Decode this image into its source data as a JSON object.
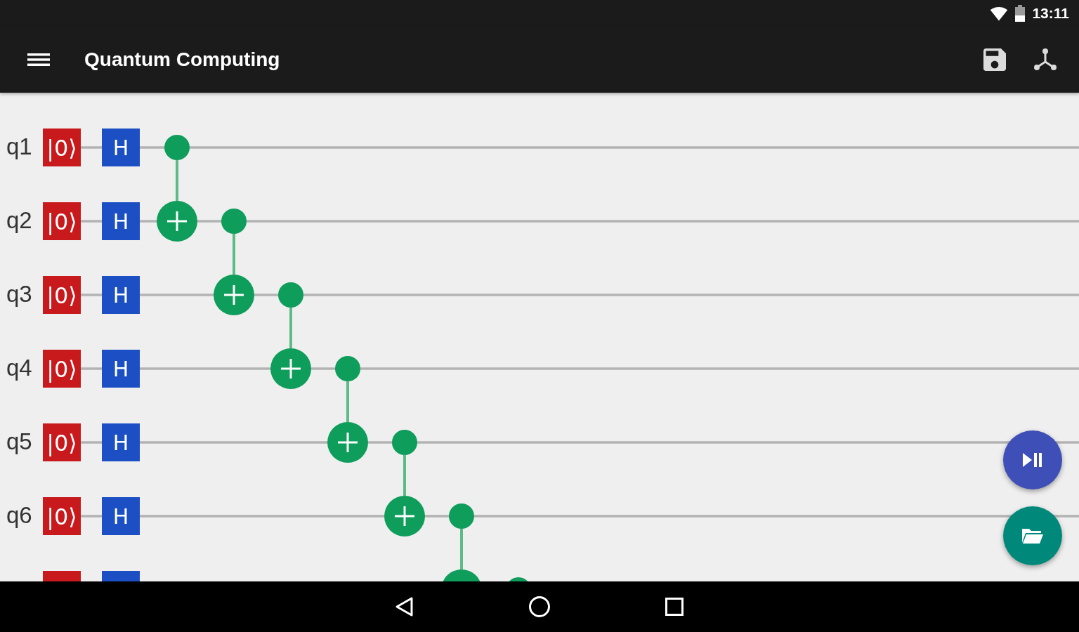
{
  "status_bar": {
    "time": "13:11"
  },
  "app_bar": {
    "title": "Quantum Computing"
  },
  "circuit": {
    "qubits": [
      {
        "label": "q1",
        "init": "|0⟩",
        "gate": "H",
        "ops": [
          {
            "kind": "control"
          }
        ]
      },
      {
        "label": "q2",
        "init": "|0⟩",
        "gate": "H",
        "ops": [
          {
            "kind": "target"
          },
          {
            "kind": "control"
          }
        ]
      },
      {
        "label": "q3",
        "init": "|0⟩",
        "gate": "H",
        "ops": [
          {
            "kind": "empty"
          },
          {
            "kind": "target"
          },
          {
            "kind": "control"
          }
        ]
      },
      {
        "label": "q4",
        "init": "|0⟩",
        "gate": "H",
        "ops": [
          {
            "kind": "empty"
          },
          {
            "kind": "empty"
          },
          {
            "kind": "target"
          },
          {
            "kind": "control"
          }
        ]
      },
      {
        "label": "q5",
        "init": "|0⟩",
        "gate": "H",
        "ops": [
          {
            "kind": "empty"
          },
          {
            "kind": "empty"
          },
          {
            "kind": "empty"
          },
          {
            "kind": "target"
          },
          {
            "kind": "control"
          }
        ]
      },
      {
        "label": "q6",
        "init": "|0⟩",
        "gate": "H",
        "ops": [
          {
            "kind": "empty"
          },
          {
            "kind": "empty"
          },
          {
            "kind": "empty"
          },
          {
            "kind": "empty"
          },
          {
            "kind": "target"
          },
          {
            "kind": "control"
          }
        ]
      },
      {
        "ops": [
          {
            "kind": "empty"
          },
          {
            "kind": "empty"
          },
          {
            "kind": "empty"
          },
          {
            "kind": "empty"
          },
          {
            "kind": "empty"
          },
          {
            "kind": "target"
          },
          {
            "kind": "control"
          }
        ]
      }
    ]
  }
}
